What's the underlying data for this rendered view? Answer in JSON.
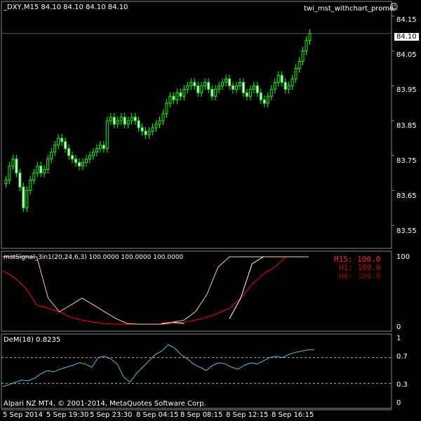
{
  "main_panel": {
    "title": "_DXY,M15  84.10 84.10 84.10 84.10",
    "script_label": "twi_mst_withchart_promo",
    "current_price": "84.10",
    "price_ticks": [
      "84.15",
      "84.05",
      "83.95",
      "83.85",
      "83.75",
      "83.65",
      "83.55"
    ],
    "colors": {
      "bull": "#00ff00",
      "bear": "#00ff00",
      "grid": "#ffffff"
    }
  },
  "signal_panel": {
    "title": "mstSignal_3in1(20,24,6,3) 100.0000 100.0000 100.0000",
    "ticks": [
      "100",
      "0"
    ],
    "legend": [
      {
        "text": "M15: 100.0",
        "color": "#ff2020"
      },
      {
        "text": "H1: 100.0",
        "color": "#cc0000"
      },
      {
        "text": "H4: 100.0",
        "color": "#990000"
      }
    ],
    "colors": {
      "red": "#ff0000",
      "white": "#ffffff",
      "orange": "#ffcc99"
    }
  },
  "dem_panel": {
    "title": "DeM(18) 0.8235",
    "ticks": [
      "1",
      "0.7",
      "0.3",
      "0"
    ],
    "levels": [
      0.7,
      0.3
    ],
    "color": "#4fc3d6"
  },
  "copyright": "Alpari NZ MT4, © 2001-2014, MetaQuotes Software Corp.",
  "time_axis": [
    "5 Sep 2014",
    "5 Sep 19:30",
    "5 Sep 23:30",
    "8 Sep 04:15",
    "8 Sep 08:15",
    "8 Sep 12:15",
    "8 Sep 16:15"
  ],
  "chart_data": [
    {
      "type": "candlestick",
      "title": "_DXY,M15",
      "ylim": [
        83.5,
        84.18
      ],
      "close": [
        83.68,
        83.72,
        83.74,
        83.7,
        83.66,
        83.6,
        83.65,
        83.68,
        83.7,
        83.72,
        83.7,
        83.71,
        83.74,
        83.76,
        83.78,
        83.8,
        83.79,
        83.77,
        83.75,
        83.74,
        83.73,
        83.72,
        83.73,
        83.74,
        83.75,
        83.76,
        83.77,
        83.78,
        83.77,
        83.85,
        83.86,
        83.84,
        83.85,
        83.86,
        83.84,
        83.85,
        83.86,
        83.85,
        83.83,
        83.82,
        83.81,
        83.82,
        83.83,
        83.84,
        83.85,
        83.87,
        83.9,
        83.92,
        83.91,
        83.93,
        83.92,
        83.94,
        83.95,
        83.96,
        83.95,
        83.93,
        83.95,
        83.96,
        83.94,
        83.92,
        83.94,
        83.95,
        83.96,
        83.97,
        83.95,
        83.94,
        83.95,
        83.96,
        83.93,
        83.92,
        83.94,
        83.95,
        83.93,
        83.91,
        83.9,
        83.92,
        83.94,
        83.96,
        83.98,
        83.96,
        83.94,
        83.95,
        83.97,
        84.0,
        84.02,
        84.05,
        84.08,
        84.1
      ]
    },
    {
      "type": "line",
      "title": "mstSignal_3in1(20,24,6,3)",
      "ylim": [
        0,
        100
      ],
      "series": [
        {
          "name": "M15",
          "values": [
            80,
            70,
            55,
            30,
            25,
            20,
            12,
            8,
            5,
            3,
            2,
            2,
            2,
            2,
            2,
            3,
            5,
            8,
            12,
            18,
            25,
            40,
            60,
            75,
            85,
            100,
            100,
            100
          ]
        },
        {
          "name": "H1",
          "values": [
            null,
            null,
            null,
            null,
            null,
            null,
            null,
            null,
            null,
            null,
            null,
            null,
            null,
            null,
            3,
            5,
            3,
            null,
            null,
            null,
            10,
            40,
            90,
            100,
            100,
            100,
            100,
            100
          ]
        },
        {
          "name": "H4",
          "values": [
            100,
            100,
            100,
            100,
            40,
            20,
            30,
            40,
            30,
            20,
            10,
            3,
            2,
            2,
            2,
            5,
            8,
            20,
            45,
            85,
            100,
            100,
            100,
            100,
            100,
            100,
            100,
            100
          ]
        }
      ]
    },
    {
      "type": "line",
      "title": "DeM(18)",
      "ylim": [
        0,
        1
      ],
      "series": [
        {
          "name": "DeM",
          "values": [
            0.25,
            0.28,
            0.32,
            0.35,
            0.34,
            0.38,
            0.45,
            0.5,
            0.48,
            0.52,
            0.55,
            0.58,
            0.62,
            0.6,
            0.55,
            0.7,
            0.72,
            0.68,
            0.6,
            0.4,
            0.32,
            0.45,
            0.55,
            0.65,
            0.75,
            0.8,
            0.9,
            0.85,
            0.75,
            0.68,
            0.6,
            0.55,
            0.5,
            0.58,
            0.62,
            0.6,
            0.55,
            0.52,
            0.58,
            0.62,
            0.6,
            0.65,
            0.7,
            0.72,
            0.7,
            0.75,
            0.78,
            0.8,
            0.82,
            0.8235
          ]
        }
      ]
    }
  ]
}
